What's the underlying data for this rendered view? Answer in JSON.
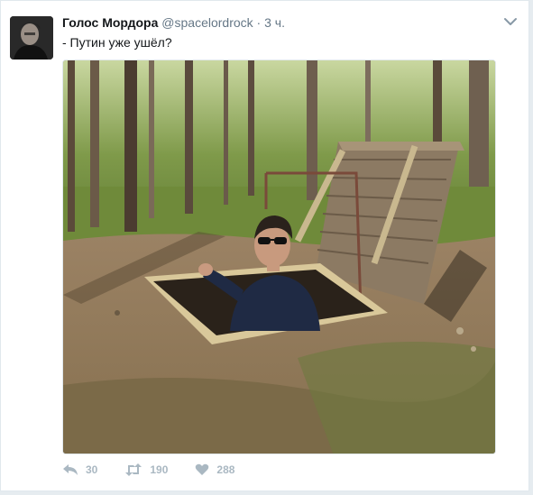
{
  "tweet": {
    "display_name": "Голос Мордора",
    "handle": "@spacelordrock",
    "separator": "·",
    "time": "3 ч.",
    "text": "- Путин уже ушёл?"
  },
  "actions": {
    "reply_count": "30",
    "retweet_count": "190",
    "like_count": "288"
  },
  "colors": {
    "name": "#14171a",
    "meta": "#657786",
    "action_icons": "#aab8c2"
  },
  "icons": [
    "chevron-down-icon",
    "reply-icon",
    "retweet-icon",
    "heart-icon"
  ]
}
